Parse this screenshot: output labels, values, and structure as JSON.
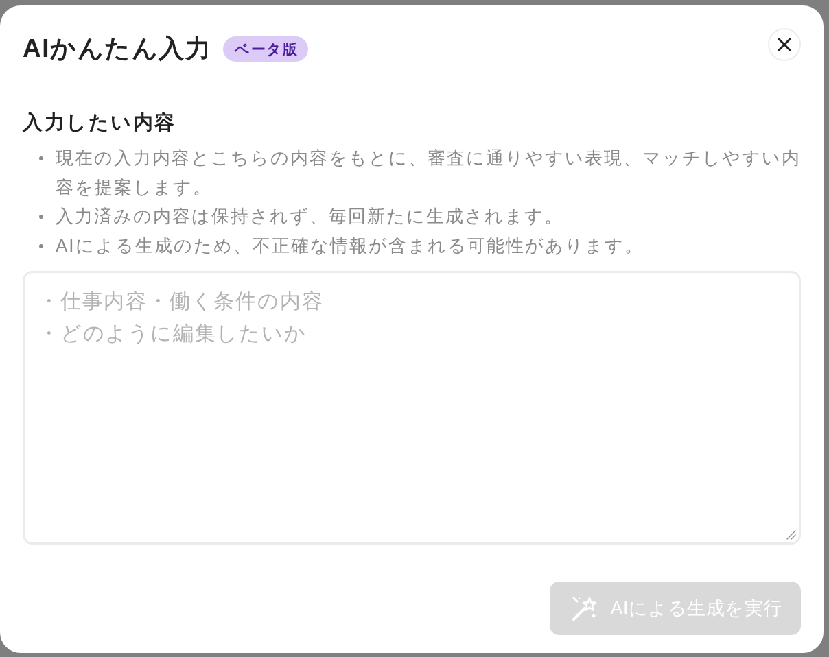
{
  "dialog": {
    "title": "AIかんたん入力",
    "badge": "ベータ版"
  },
  "section": {
    "heading": "入力したい内容",
    "notes": [
      "現在の入力内容とこちらの内容をもとに、審査に通りやすい表現、マッチしやすい内容を提案します。",
      "入力済みの内容は保持されず、毎回新たに生成されます。",
      "AIによる生成のため、不正確な情報が含まれる可能性があります。"
    ]
  },
  "textarea": {
    "placeholder": [
      "・仕事内容・働く条件の内容",
      "・どのように編集したいか"
    ]
  },
  "submit_button": {
    "label": "AIによる生成を実行",
    "disabled": true
  }
}
